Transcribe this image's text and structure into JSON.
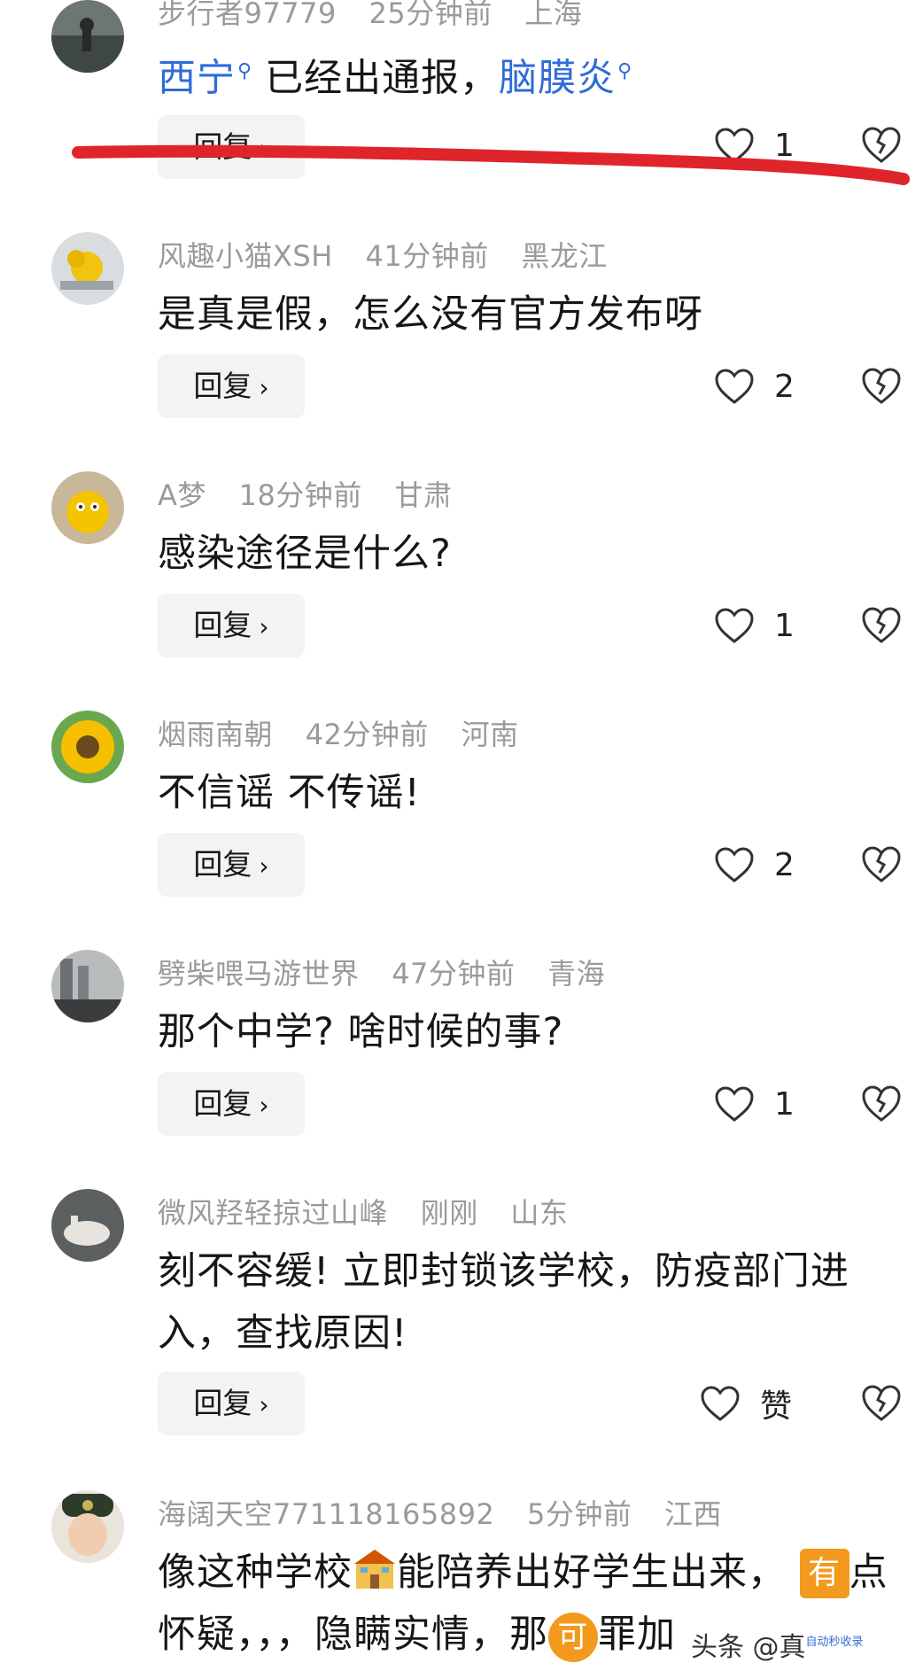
{
  "comments": [
    {
      "user": "步行者97779",
      "time": "25分钟前",
      "location": "上海",
      "text_link1": "西宁",
      "text_mid": "已经出通报，",
      "text_link2": "脑膜炎",
      "reply": "回复",
      "likes": "1"
    },
    {
      "user": "风趣小猫XSH",
      "time": "41分钟前",
      "location": "黑龙江",
      "text": "是真是假，怎么没有官方发布呀",
      "reply": "回复",
      "likes": "2"
    },
    {
      "user": "A梦",
      "time": "18分钟前",
      "location": "甘肃",
      "text": "感染途径是什么?",
      "reply": "回复",
      "likes": "1"
    },
    {
      "user": "烟雨南朝",
      "time": "42分钟前",
      "location": "河南",
      "text": "不信谣 不传谣!",
      "reply": "回复",
      "likes": "2"
    },
    {
      "user": "劈柴喂马游世界",
      "time": "47分钟前",
      "location": "青海",
      "text": "那个中学? 啥时候的事?",
      "reply": "回复",
      "likes": "1"
    },
    {
      "user": "微风羟轻掠过山峰",
      "time": "刚刚",
      "location": "山东",
      "text": "刻不容缓! 立即封锁该学校，防疫部门进入，查找原因!",
      "reply": "回复",
      "likes": "赞"
    },
    {
      "user": "海阔天空771118165892",
      "time": "5分钟前",
      "location": "江西",
      "text_part1": "像这种学校",
      "text_part2": "能陪养出好学生出来，",
      "tag_you": "有",
      "text_part3": "点怀疑，，，隐瞒实情，那",
      "tag_ke": "可",
      "text_part4": "罪加"
    }
  ],
  "watermark": {
    "text": "头条 @真",
    "tiny": "自动秒收录"
  },
  "colors": {
    "link": "#2f6bd8",
    "annotation_line": "#e0242b",
    "meta": "#9a9a9a",
    "button_bg": "#f3f3f3"
  }
}
